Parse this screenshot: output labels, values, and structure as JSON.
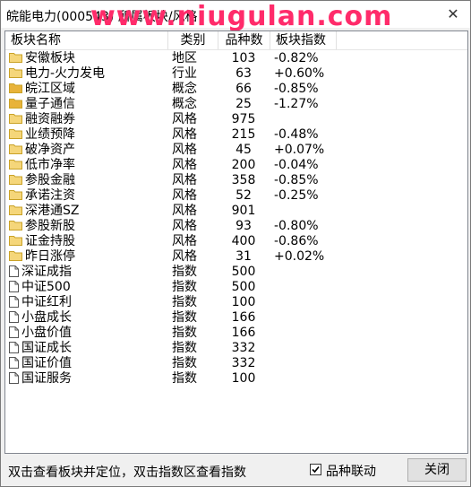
{
  "window": {
    "title": "皖能电力(000543) 所属板块/风格"
  },
  "watermark": "www.niugulan.com",
  "columns": [
    "板块名称",
    "类别",
    "品种数",
    "板块指数"
  ],
  "rows": [
    {
      "name": "安徽板块",
      "type": "地区",
      "count": "103",
      "pct": "-0.82%",
      "icon": "folder"
    },
    {
      "name": "电力-火力发电",
      "type": "行业",
      "count": "63",
      "pct": "+0.60%",
      "icon": "folder"
    },
    {
      "name": "皖江区域",
      "type": "概念",
      "count": "66",
      "pct": "-0.85%",
      "icon": "folder-filled"
    },
    {
      "name": "量子通信",
      "type": "概念",
      "count": "25",
      "pct": "-1.27%",
      "icon": "folder-filled"
    },
    {
      "name": "融资融券",
      "type": "风格",
      "count": "975",
      "pct": "",
      "icon": "folder"
    },
    {
      "name": "业绩预降",
      "type": "风格",
      "count": "215",
      "pct": "-0.48%",
      "icon": "folder"
    },
    {
      "name": "破净资产",
      "type": "风格",
      "count": "45",
      "pct": "+0.07%",
      "icon": "folder"
    },
    {
      "name": "低市净率",
      "type": "风格",
      "count": "200",
      "pct": "-0.04%",
      "icon": "folder"
    },
    {
      "name": "参股金融",
      "type": "风格",
      "count": "358",
      "pct": "-0.85%",
      "icon": "folder"
    },
    {
      "name": "承诺注资",
      "type": "风格",
      "count": "52",
      "pct": "-0.25%",
      "icon": "folder"
    },
    {
      "name": "深港通SZ",
      "type": "风格",
      "count": "901",
      "pct": "",
      "icon": "folder"
    },
    {
      "name": "参股新股",
      "type": "风格",
      "count": "93",
      "pct": "-0.80%",
      "icon": "folder"
    },
    {
      "name": "证金持股",
      "type": "风格",
      "count": "400",
      "pct": "-0.86%",
      "icon": "folder"
    },
    {
      "name": "昨日涨停",
      "type": "风格",
      "count": "31",
      "pct": "+0.02%",
      "icon": "folder"
    },
    {
      "name": "深证成指",
      "type": "指数",
      "count": "500",
      "pct": "",
      "icon": "doc"
    },
    {
      "name": "中证500",
      "type": "指数",
      "count": "500",
      "pct": "",
      "icon": "doc"
    },
    {
      "name": "中证红利",
      "type": "指数",
      "count": "100",
      "pct": "",
      "icon": "doc"
    },
    {
      "name": "小盘成长",
      "type": "指数",
      "count": "166",
      "pct": "",
      "icon": "doc"
    },
    {
      "name": "小盘价值",
      "type": "指数",
      "count": "166",
      "pct": "",
      "icon": "doc"
    },
    {
      "name": "国证成长",
      "type": "指数",
      "count": "332",
      "pct": "",
      "icon": "doc"
    },
    {
      "name": "国证价值",
      "type": "指数",
      "count": "332",
      "pct": "",
      "icon": "doc"
    },
    {
      "name": "国证服务",
      "type": "指数",
      "count": "100",
      "pct": "",
      "icon": "doc"
    }
  ],
  "footer": {
    "hint": "双击查看板块并定位，双击指数区查看指数",
    "checkbox_label": "品种联动",
    "checkbox_checked": true,
    "close_label": "关闭"
  },
  "colors": {
    "folder": "#f5d67a",
    "folder_edge": "#c9a227",
    "folder_filled": "#e8b33a"
  }
}
